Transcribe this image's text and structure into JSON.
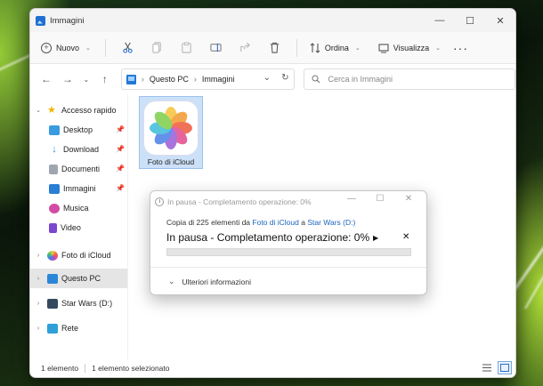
{
  "window": {
    "title": "Immagini",
    "controls": [
      "—",
      "☐",
      "✕"
    ]
  },
  "toolbar": {
    "new_label": "Nuovo",
    "sort_label": "Ordina",
    "view_label": "Visualizza",
    "more_label": "···"
  },
  "address": {
    "segments": [
      "Questo PC",
      "Immagini"
    ],
    "separator": "›"
  },
  "search": {
    "placeholder": "Cerca in Immagini"
  },
  "sidebar": {
    "quick_access": "Accesso rapido",
    "items": [
      {
        "label": "Desktop",
        "icon": "desktop-icon",
        "color": "#3a9be0",
        "pinned": true
      },
      {
        "label": "Download",
        "icon": "download-icon",
        "color": "#2e8ad6",
        "pinned": true
      },
      {
        "label": "Documenti",
        "icon": "documents-icon",
        "color": "#8a8f99",
        "pinned": true
      },
      {
        "label": "Immagini",
        "icon": "pictures-icon",
        "color": "#2a7fd4",
        "pinned": true
      },
      {
        "label": "Musica",
        "icon": "music-icon",
        "color": "#d24ca3",
        "pinned": false
      },
      {
        "label": "Video",
        "icon": "video-icon",
        "color": "#7a48d0",
        "pinned": false
      }
    ],
    "roots": [
      {
        "label": "Foto di iCloud",
        "icon": "icloud-photos-icon"
      },
      {
        "label": "Questo PC",
        "icon": "this-pc-icon",
        "selected": true
      },
      {
        "label": "Star Wars (D:)",
        "icon": "drive-icon"
      },
      {
        "label": "Rete",
        "icon": "network-icon"
      }
    ]
  },
  "files": [
    {
      "label": "Foto di iCloud",
      "icon": "photos-app-icon"
    }
  ],
  "dialog": {
    "title": "In pausa - Completamento operazione: 0%",
    "subtitle_prefix": "Copia di 225 elementi da ",
    "source": "Foto di iCloud",
    "subtitle_mid": " a ",
    "destination": "Star Wars (D:)",
    "main_text": "In pausa - Completamento operazione: 0%",
    "progress": 0,
    "resume_label": "▶",
    "cancel_label": "✕",
    "more_label": "Ulteriori informazioni"
  },
  "status": {
    "count": "1 elemento",
    "selected": "1 elemento selezionato"
  }
}
